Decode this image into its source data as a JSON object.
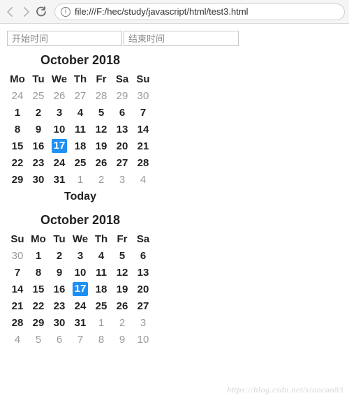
{
  "browser": {
    "url": "file:///F:/hec/study/javascript/html/test3.html",
    "info_glyph": "i"
  },
  "inputs": {
    "start_placeholder": "开始时间",
    "end_placeholder": "结束时间"
  },
  "calendar1": {
    "title": "October 2018",
    "dow": [
      "Mo",
      "Tu",
      "We",
      "Th",
      "Fr",
      "Sa",
      "Su"
    ],
    "weeks": [
      [
        {
          "d": 24,
          "m": true
        },
        {
          "d": 25,
          "m": true
        },
        {
          "d": 26,
          "m": true
        },
        {
          "d": 27,
          "m": true
        },
        {
          "d": 28,
          "m": true
        },
        {
          "d": 29,
          "m": true
        },
        {
          "d": 30,
          "m": true
        }
      ],
      [
        {
          "d": 1
        },
        {
          "d": 2
        },
        {
          "d": 3
        },
        {
          "d": 4
        },
        {
          "d": 5
        },
        {
          "d": 6
        },
        {
          "d": 7
        }
      ],
      [
        {
          "d": 8
        },
        {
          "d": 9
        },
        {
          "d": 10
        },
        {
          "d": 11
        },
        {
          "d": 12
        },
        {
          "d": 13
        },
        {
          "d": 14
        }
      ],
      [
        {
          "d": 15
        },
        {
          "d": 16
        },
        {
          "d": 17,
          "s": true
        },
        {
          "d": 18
        },
        {
          "d": 19
        },
        {
          "d": 20
        },
        {
          "d": 21
        }
      ],
      [
        {
          "d": 22
        },
        {
          "d": 23
        },
        {
          "d": 24
        },
        {
          "d": 25
        },
        {
          "d": 26
        },
        {
          "d": 27
        },
        {
          "d": 28
        }
      ],
      [
        {
          "d": 29
        },
        {
          "d": 30
        },
        {
          "d": 31
        },
        {
          "d": 1,
          "m": true
        },
        {
          "d": 2,
          "m": true
        },
        {
          "d": 3,
          "m": true
        },
        {
          "d": 4,
          "m": true
        }
      ]
    ]
  },
  "today_label": "Today",
  "calendar2": {
    "title": "October 2018",
    "dow": [
      "Su",
      "Mo",
      "Tu",
      "We",
      "Th",
      "Fr",
      "Sa"
    ],
    "weeks": [
      [
        {
          "d": 30,
          "m": true
        },
        {
          "d": 1
        },
        {
          "d": 2
        },
        {
          "d": 3
        },
        {
          "d": 4
        },
        {
          "d": 5
        },
        {
          "d": 6
        }
      ],
      [
        {
          "d": 7
        },
        {
          "d": 8
        },
        {
          "d": 9
        },
        {
          "d": 10
        },
        {
          "d": 11
        },
        {
          "d": 12
        },
        {
          "d": 13
        }
      ],
      [
        {
          "d": 14
        },
        {
          "d": 15
        },
        {
          "d": 16
        },
        {
          "d": 17,
          "s": true
        },
        {
          "d": 18
        },
        {
          "d": 19
        },
        {
          "d": 20
        }
      ],
      [
        {
          "d": 21
        },
        {
          "d": 22
        },
        {
          "d": 23
        },
        {
          "d": 24
        },
        {
          "d": 25
        },
        {
          "d": 26
        },
        {
          "d": 27
        }
      ],
      [
        {
          "d": 28
        },
        {
          "d": 29
        },
        {
          "d": 30
        },
        {
          "d": 31
        },
        {
          "d": 1,
          "m": true
        },
        {
          "d": 2,
          "m": true
        },
        {
          "d": 3,
          "m": true
        }
      ],
      [
        {
          "d": 4,
          "m": true
        },
        {
          "d": 5,
          "m": true
        },
        {
          "d": 6,
          "m": true
        },
        {
          "d": 7,
          "m": true
        },
        {
          "d": 8,
          "m": true
        },
        {
          "d": 9,
          "m": true
        },
        {
          "d": 10,
          "m": true
        }
      ]
    ]
  },
  "watermark": "https://blog.csdn.net/xiaocao83"
}
